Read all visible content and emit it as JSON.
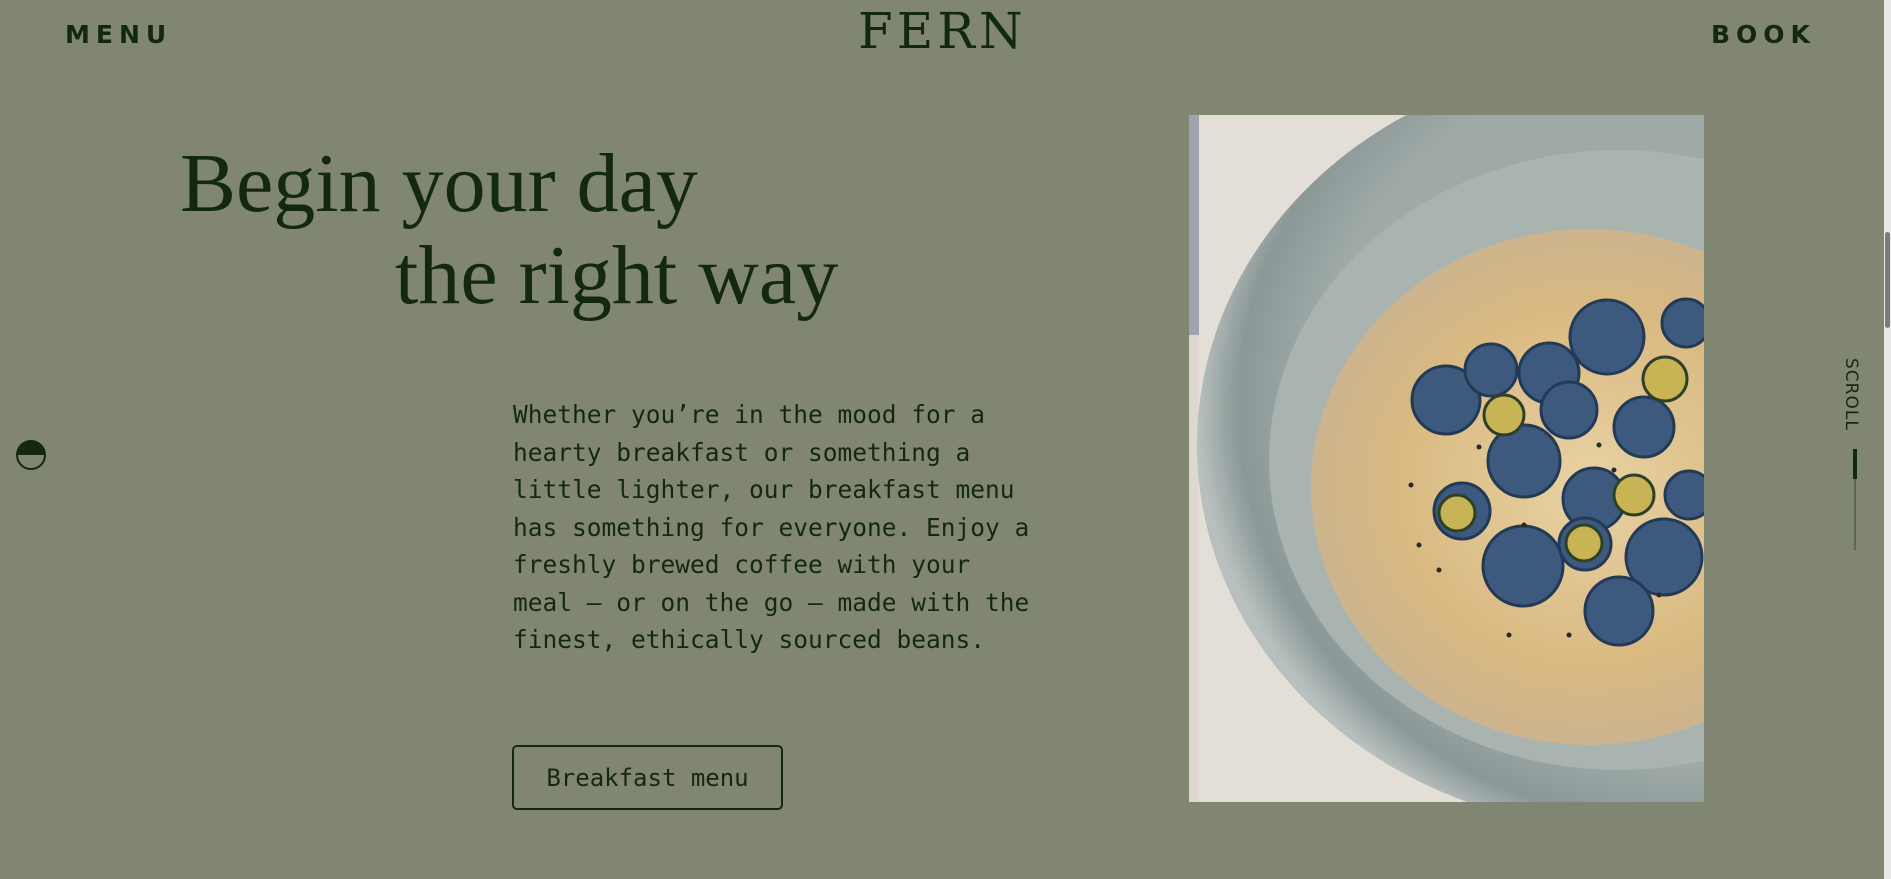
{
  "header": {
    "menu_label": "MENU",
    "logo_text": "FERN",
    "book_label": "BOOK"
  },
  "hero": {
    "headline_line1": "Begin your day",
    "headline_line2": "the right way",
    "body": "Whether you’re in the mood for a hearty breakfast or something a little lighter, our breakfast menu has something for everyone. Enjoy a freshly brewed coffee with your meal — or on the go — made with the finest, ethically sourced beans.",
    "cta_label": "Breakfast menu"
  },
  "scroll_indicator": {
    "label": "SCROLL"
  },
  "colors": {
    "background": "#818672",
    "text": "#13290f"
  },
  "icons": {
    "theme_toggle": "half-circle-icon"
  }
}
